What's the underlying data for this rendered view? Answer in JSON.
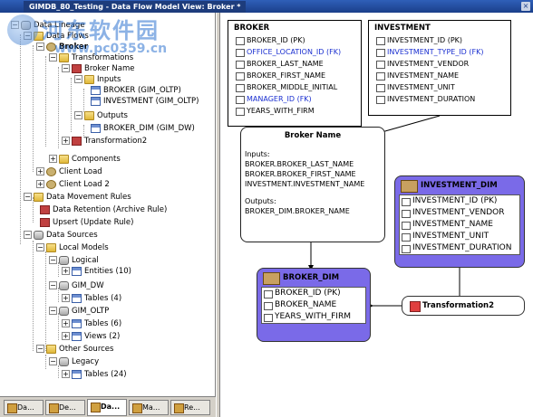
{
  "title_bar": {
    "tab_label": "GIMDB_80_Testing - Data Flow Model View: Broker *",
    "close_label": "×"
  },
  "watermark": {
    "text": "河东软件园",
    "url": "www.pc0359.cn"
  },
  "tree": {
    "items": [
      {
        "label": "Data Lineage"
      },
      {
        "label": "Data Flows"
      },
      {
        "label": "Broker"
      },
      {
        "label": "Transformations"
      },
      {
        "label": "Broker Name"
      },
      {
        "label": "Inputs"
      },
      {
        "label": "BROKER (GIM_OLTP)"
      },
      {
        "label": "INVESTMENT (GIM_OLTP)"
      },
      {
        "label": "Outputs"
      },
      {
        "label": "BROKER_DIM (GIM_DW)"
      },
      {
        "label": "Transformation2"
      },
      {
        "label": "Components"
      },
      {
        "label": "Client Load"
      },
      {
        "label": "Client Load 2"
      },
      {
        "label": "Data Movement Rules"
      },
      {
        "label": "Data Retention (Archive Rule)"
      },
      {
        "label": "Upsert (Update Rule)"
      },
      {
        "label": "Data Sources"
      },
      {
        "label": "Local Models"
      },
      {
        "label": "Logical"
      },
      {
        "label": "Entities (10)"
      },
      {
        "label": "GIM_DW"
      },
      {
        "label": "Tables (4)"
      },
      {
        "label": "GIM_OLTP"
      },
      {
        "label": "Tables (6)"
      },
      {
        "label": "Views (2)"
      },
      {
        "label": "Other Sources"
      },
      {
        "label": "Legacy"
      },
      {
        "label": "Tables (24)"
      }
    ]
  },
  "bottom_tabs": [
    {
      "label": "Da..."
    },
    {
      "label": "De..."
    },
    {
      "label": "Da...",
      "active": true
    },
    {
      "label": "Ma..."
    },
    {
      "label": "Re..."
    }
  ],
  "diagram": {
    "broker": {
      "title": "BROKER",
      "rows": [
        {
          "label": "BROKER_ID (PK)",
          "blue": false
        },
        {
          "label": "OFFICE_LOCATION_ID (FK)",
          "blue": true
        },
        {
          "label": "BROKER_LAST_NAME",
          "blue": false
        },
        {
          "label": "BROKER_FIRST_NAME",
          "blue": false
        },
        {
          "label": "BROKER_MIDDLE_INITIAL",
          "blue": false
        },
        {
          "label": "MANAGER_ID (FK)",
          "blue": true
        },
        {
          "label": "YEARS_WITH_FIRM",
          "blue": false
        }
      ]
    },
    "investment": {
      "title": "INVESTMENT",
      "rows": [
        {
          "label": "INVESTMENT_ID (PK)",
          "blue": false
        },
        {
          "label": "INVESTMENT_TYPE_ID (FK)",
          "blue": true
        },
        {
          "label": "INVESTMENT_VENDOR",
          "blue": false
        },
        {
          "label": "INVESTMENT_NAME",
          "blue": false
        },
        {
          "label": "INVESTMENT_UNIT",
          "blue": false
        },
        {
          "label": "INVESTMENT_DURATION",
          "blue": false
        }
      ]
    },
    "transformation": {
      "title": "Broker Name",
      "inputs_label": "Inputs:",
      "inputs": [
        "BROKER.BROKER_LAST_NAME",
        "BROKER.BROKER_FIRST_NAME",
        "INVESTMENT.INVESTMENT_NAME"
      ],
      "outputs_label": "Outputs:",
      "outputs": [
        "BROKER_DIM.BROKER_NAME"
      ]
    },
    "broker_dim": {
      "title": "BROKER_DIM",
      "rows": [
        "BROKER_ID (PK)",
        "BROKER_NAME",
        "YEARS_WITH_FIRM"
      ]
    },
    "investment_dim": {
      "title": "INVESTMENT_DIM",
      "rows": [
        "INVESTMENT_ID (PK)",
        "INVESTMENT_VENDOR",
        "INVESTMENT_NAME",
        "INVESTMENT_UNIT",
        "INVESTMENT_DURATION"
      ]
    },
    "transformation2": {
      "title": "Transformation2"
    }
  },
  "colors": {
    "title_bar": "#2f5fb8",
    "dim_header": "#7a6ae8",
    "fk_text": "#1a2fd0"
  }
}
